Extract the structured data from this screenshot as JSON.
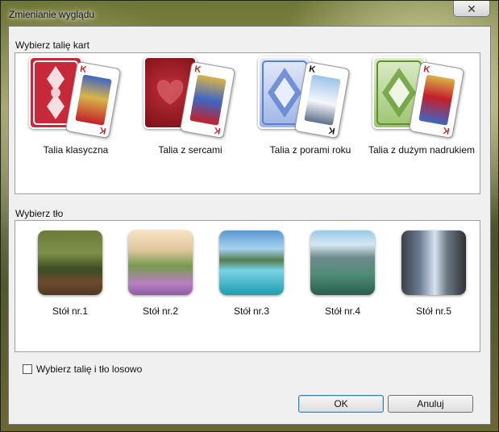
{
  "window": {
    "title": "Zmienianie wyglądu",
    "close_icon": "close-icon"
  },
  "decks": {
    "label": "Wybierz talię kart",
    "items": [
      {
        "label": "Talia klasyczna",
        "back_color": "#c7283a",
        "face_letter": "K",
        "suit_color": "#c41f2a"
      },
      {
        "label": "Talia z sercami",
        "back_color": "#8f1119",
        "face_letter": "K",
        "suit_color": "#c41f2a"
      },
      {
        "label": "Talia z porami roku",
        "back_color": "#5d7fd0",
        "face_letter": "K",
        "suit_color": "#111111"
      },
      {
        "label": "Talia z dużym nadrukiem",
        "back_color": "#6ea03f",
        "face_letter": "K",
        "suit_color": "#c41f2a"
      }
    ]
  },
  "backgrounds": {
    "label": "Wybierz tło",
    "items": [
      {
        "label": "Stół nr.1"
      },
      {
        "label": "Stół nr.2"
      },
      {
        "label": "Stół nr.3"
      },
      {
        "label": "Stół nr.4"
      },
      {
        "label": "Stół nr.5"
      }
    ]
  },
  "random": {
    "label": "Wybierz talię i tło losowo",
    "checked": false
  },
  "buttons": {
    "ok": "OK",
    "cancel": "Anuluj"
  }
}
